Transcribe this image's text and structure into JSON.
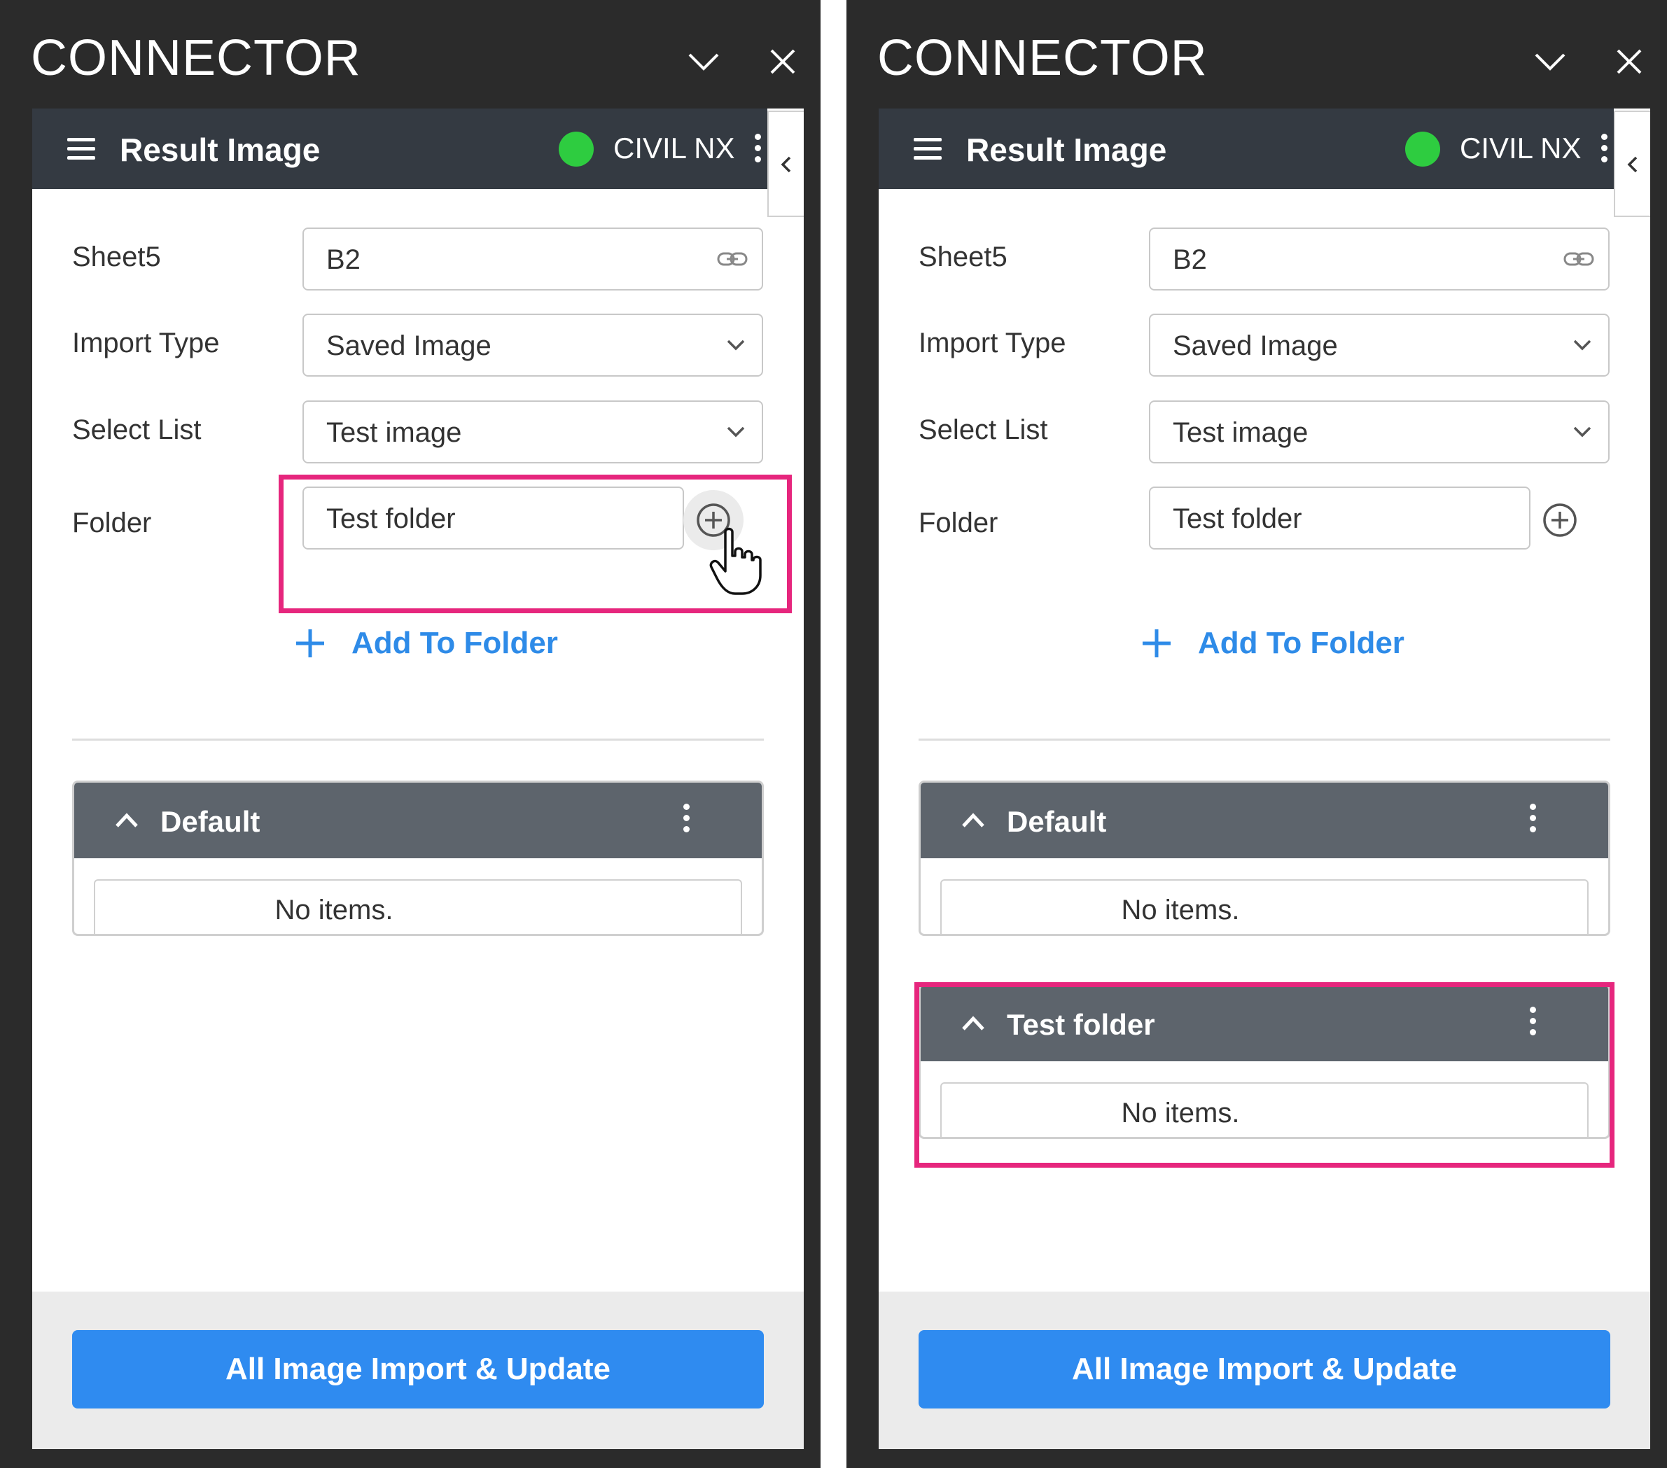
{
  "pane_title": "CONNECTOR",
  "colors": {
    "highlight": "#e6267d",
    "accent": "#2f8bf0",
    "status_connected": "#2ecc40",
    "topbar_bg": "#343a42",
    "group_header_bg": "#5d646c"
  },
  "topbar": {
    "title": "Result Image",
    "app_name": "CIVIL NX",
    "status": "connected",
    "icons": [
      "hamburger-icon",
      "status-dot-icon",
      "kebab-icon"
    ]
  },
  "form": {
    "sheet_label": "Sheet5",
    "sheet_value": "B2",
    "import_type_label": "Import Type",
    "import_type_value": "Saved Image",
    "select_list_label": "Select List",
    "select_list_value": "Test image",
    "folder_label": "Folder",
    "folder_value": "Test folder"
  },
  "add_to_folder_label": "Add To Folder",
  "left": {
    "groups": [
      {
        "title": "Default",
        "empty_text": "No items."
      }
    ]
  },
  "right": {
    "groups": [
      {
        "title": "Default",
        "empty_text": "No items."
      },
      {
        "title": "Test folder",
        "empty_text": "No items."
      }
    ]
  },
  "footer_button_label": "All Image Import & Update"
}
